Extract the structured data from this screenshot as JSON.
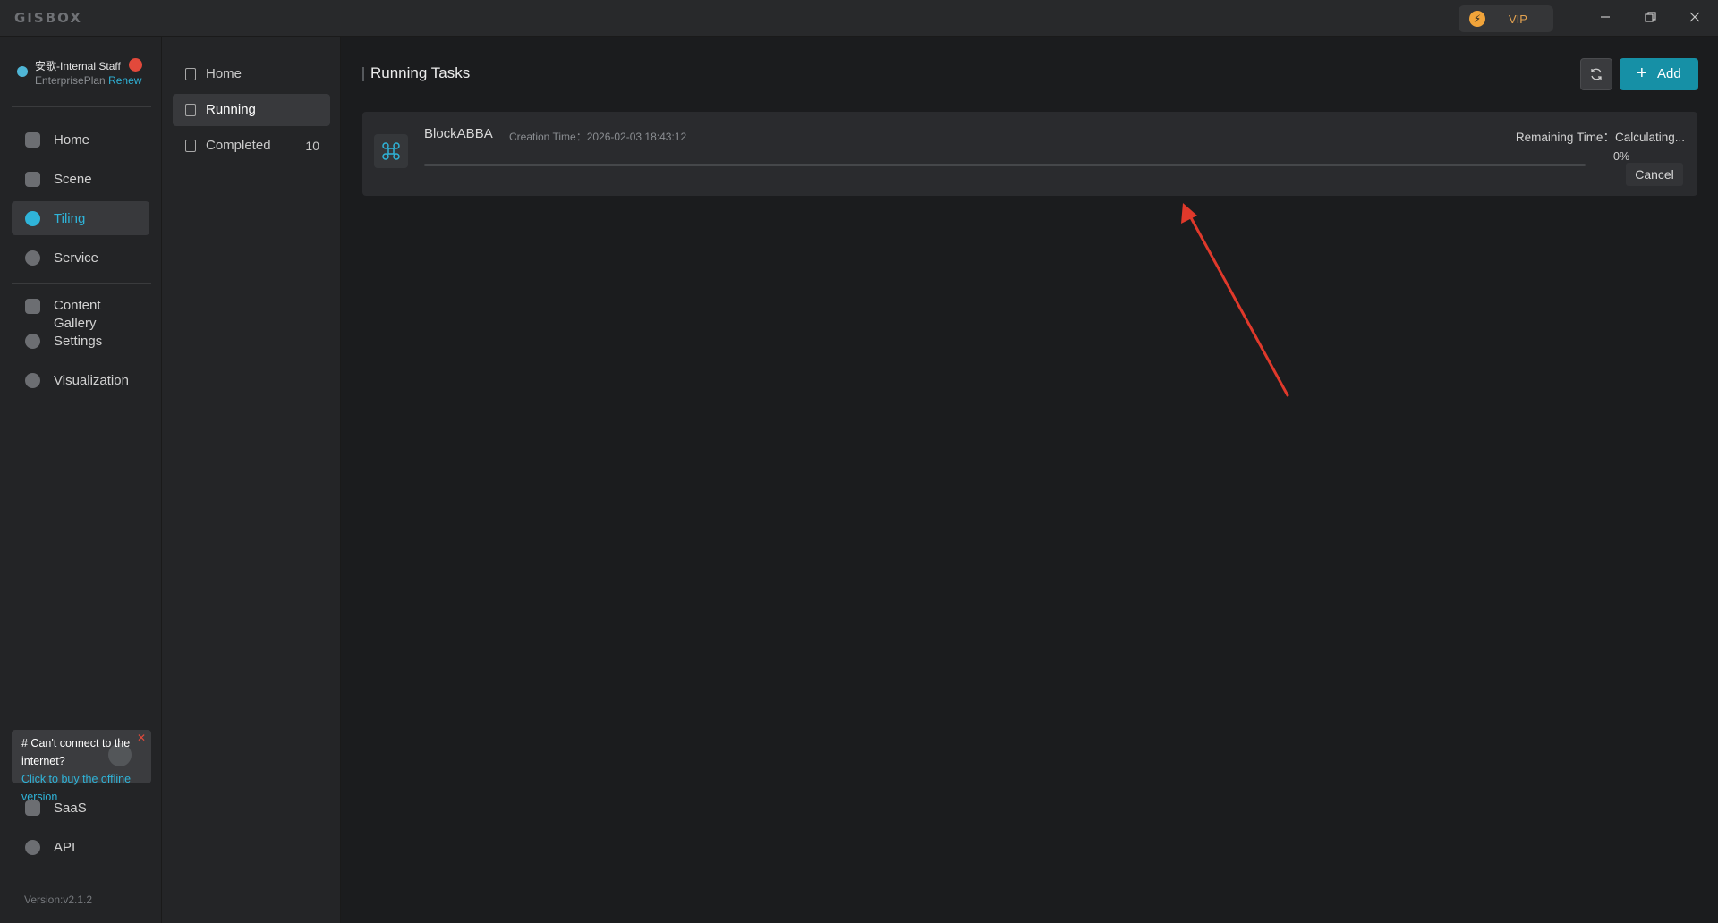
{
  "app": {
    "logo": "GISBOX"
  },
  "titlebar": {
    "vip_label": "VIP",
    "vip_icon": "lightning-icon"
  },
  "user": {
    "name": "安歌-Internal Staff",
    "plan": "EnterprisePlan",
    "renew": "Renew"
  },
  "sidebar": {
    "items": [
      {
        "label": "Home",
        "icon": "home-icon",
        "active": false
      },
      {
        "label": "Scene",
        "icon": "cube-icon",
        "active": false
      },
      {
        "label": "Tiling",
        "icon": "swap-icon",
        "active": true
      },
      {
        "label": "Service",
        "icon": "upload-icon",
        "active": false
      },
      {
        "label": "Content Gallery",
        "icon": "image-icon",
        "active": false
      },
      {
        "label": "Settings",
        "icon": "gear-icon",
        "active": false
      },
      {
        "label": "Visualization",
        "icon": "visualization-icon",
        "active": false
      },
      {
        "label": "SaaS",
        "icon": "code-icon",
        "active": false
      },
      {
        "label": "API",
        "icon": "api-icon",
        "active": false
      }
    ],
    "promo": {
      "title": "# Can't connect to the internet?",
      "link": "Click to buy the offline version"
    },
    "version": "Version:v2.1.2"
  },
  "submenu": {
    "items": [
      {
        "label": "Home",
        "count": ""
      },
      {
        "label": "Running",
        "count": ""
      },
      {
        "label": "Completed",
        "count": "10"
      }
    ]
  },
  "main": {
    "title": "Running Tasks",
    "add_label": "Add",
    "tasks": [
      {
        "name": "BlockABBA",
        "created": "Creation Time：2026-02-03 18:43:12",
        "remaining": "Remaining Time：Calculating...",
        "progress": 0,
        "progress_text": "0%",
        "cancel_label": "Cancel"
      }
    ]
  },
  "colors": {
    "accent": "#2fb4d9",
    "primary_button": "#1690a6",
    "annotation_arrow": "#e0392b"
  }
}
